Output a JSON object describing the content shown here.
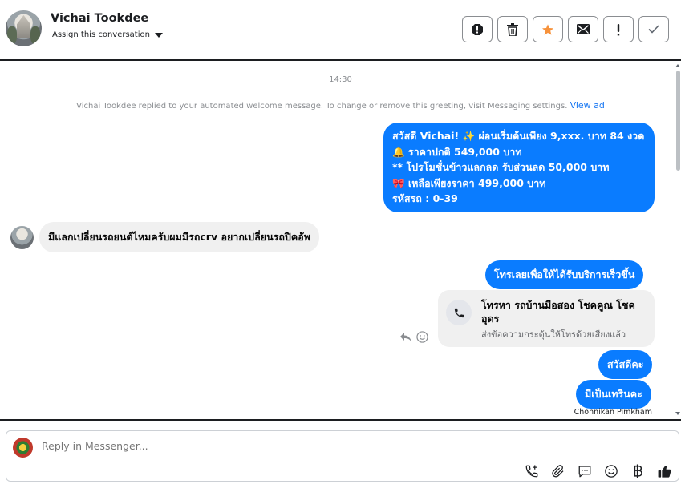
{
  "header": {
    "name": "Vichai Tookdee",
    "assign_label": "Assign this conversation",
    "actions": [
      "spam-icon",
      "trash-icon",
      "star-icon",
      "mail-icon",
      "important-icon",
      "check-icon"
    ]
  },
  "chat": {
    "time": "14:30",
    "system_message": "Vichai Tookdee replied to your automated welcome message. To change or remove this greeting, visit Messaging settings.",
    "system_link": "View ad",
    "outgoing_promo": {
      "line1": "สวัสดี Vichai! ✨  ผ่อนเริ่มต้นเพียง 9,xxx. บาท 84 งวด",
      "line2": "🔔 ราคาปกติ 549,000 บาท",
      "line3": "** โปรโมชั่นข้าวแลกลด รับส่วนลด 50,000 บาท",
      "line4": "🎀  เหลือเพียงราคา 499,000 บาท",
      "line5": " รหัสรถ : 0-39"
    },
    "incoming_message": "มีแลกเปลี่ยนรถยนต์ไหมครับผมมีรถcrv อยากเปลี่ยนรถปิคอัพ",
    "outgoing_call_cta": "โทรเลยเพื่อให้ได้รับบริการเร็วขึ้น",
    "call_card": {
      "title": "โทรหา รถบ้านมือสอง โชคคูณ โชคอุดร",
      "subtitle": "ส่งข้อความกระตุ้นให้โทรด้วยเสียงแล้ว"
    },
    "outgoing_hello": "สวัสดีคะ",
    "outgoing_installment": "มีเป็นเทรินคะ",
    "sender_name": "Chonnikan Pimkham"
  },
  "composer": {
    "placeholder": "Reply in Messenger...",
    "tools": [
      "call-add-icon",
      "attach-icon",
      "saved-reply-icon",
      "emoji-icon",
      "baht-icon",
      "thumbs-up-icon"
    ]
  },
  "colors": {
    "accent": "#0a7cff",
    "star": "#f7923b"
  }
}
